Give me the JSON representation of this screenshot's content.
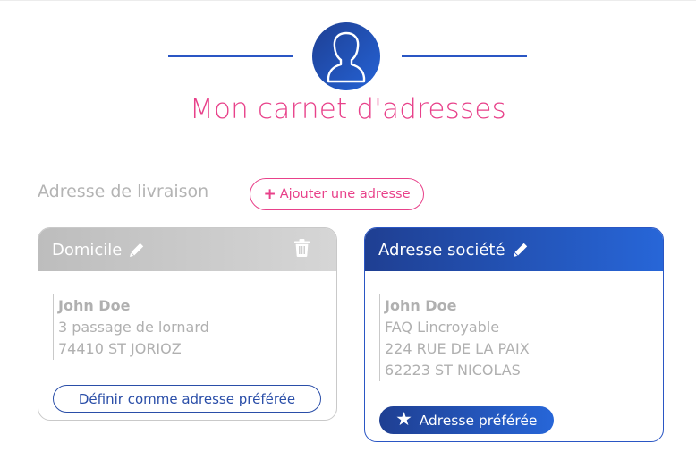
{
  "header": {
    "title": "Mon carnet d'adresses",
    "avatar_icon": "user-avatar-icon"
  },
  "section": {
    "label": "Adresse de livraison",
    "add_button": {
      "plus": "+",
      "label": "Ajouter une adresse"
    }
  },
  "addresses": [
    {
      "title": "Domicile",
      "name": "John Doe",
      "lines": [
        "3 passage de lornard",
        "74410 ST JORIOZ"
      ],
      "action_label": "Définir comme adresse préférée",
      "preferred": false
    },
    {
      "title": "Adresse société",
      "name": "John Doe",
      "lines": [
        "FAQ Lincroyable",
        "224 RUE DE LA PAIX",
        "62223 ST NICOLAS"
      ],
      "badge_label": "Adresse préférée",
      "preferred": true
    }
  ],
  "colors": {
    "accent_pink": "#e8418a",
    "brand_blue": "#2a56c4",
    "header_grey": "#c8c8c8"
  }
}
